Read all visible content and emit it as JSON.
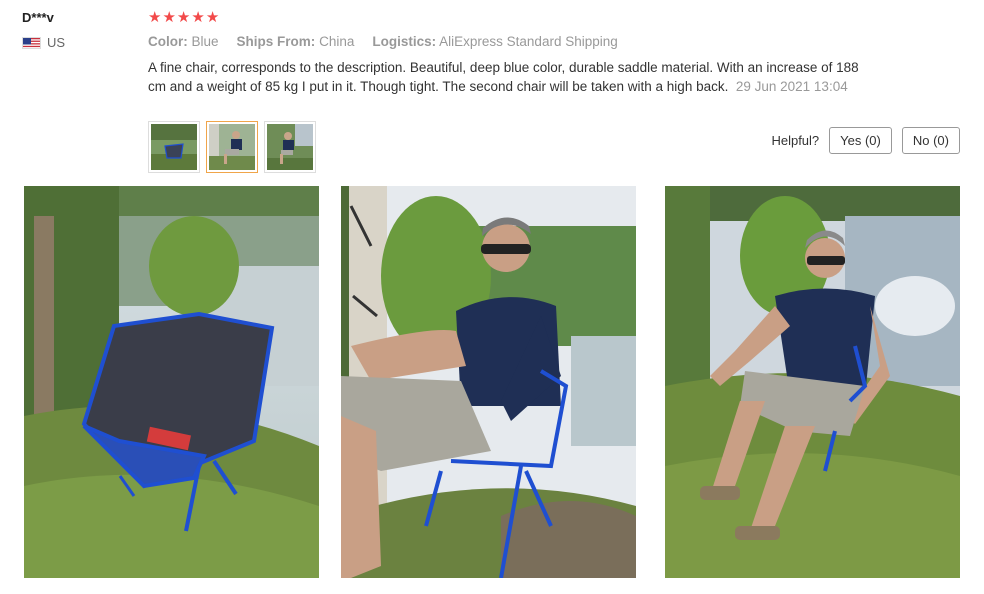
{
  "reviewer": {
    "name": "D***v",
    "country": "US",
    "rating": 5
  },
  "attributes": {
    "color_label": "Color:",
    "color_value": "Blue",
    "ships_label": "Ships From:",
    "ships_value": "China",
    "logistics_label": "Logistics:",
    "logistics_value": "AliExpress Standard Shipping"
  },
  "review": {
    "text": "A fine chair, corresponds to the description. Beautiful, deep blue color, durable saddle material. With an increase of 188 cm and a weight of 85 kg I put in it. Though tight. The second chair will be taken with a high back.",
    "date": "29 Jun 2021 13:04"
  },
  "helpful": {
    "label": "Helpful?",
    "yes": "Yes (0)",
    "no": "No (0)"
  },
  "colors": {
    "star": "#f24a4a",
    "active_thumb": "#f0a54a",
    "chair_blue": "#1f4fd1"
  }
}
